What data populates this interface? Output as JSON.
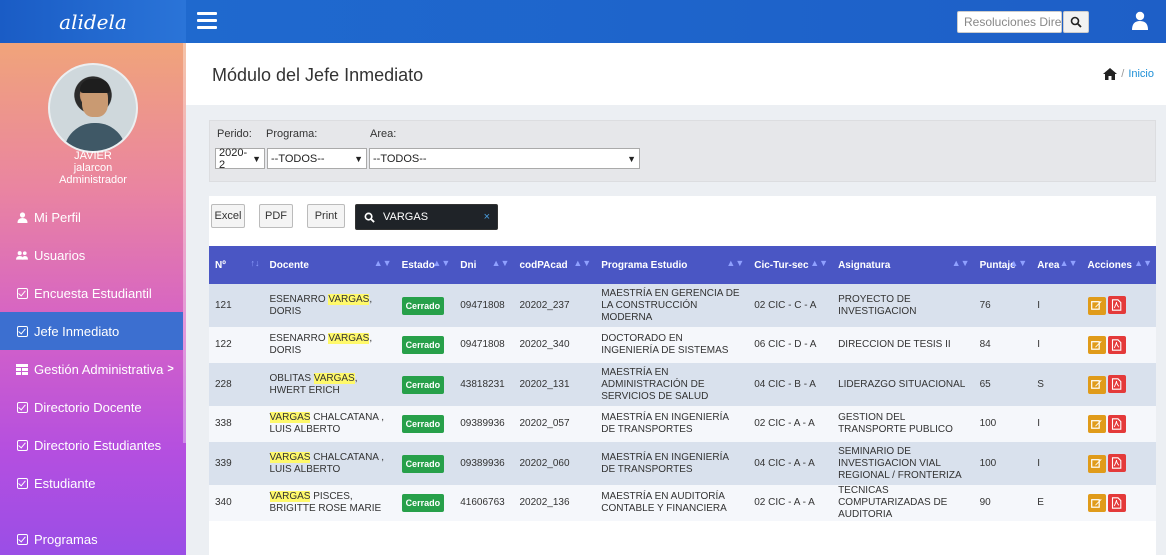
{
  "topbar": {
    "brand": "alidela",
    "search_placeholder": "Resoluciones Directo"
  },
  "sidebar": {
    "name": "JAVIER",
    "username": "jalarcon",
    "role": "Administrador",
    "items": [
      {
        "label": "Mi Perfil",
        "icon": "user-icon"
      },
      {
        "label": "Usuarios",
        "icon": "users-icon"
      },
      {
        "label": "Encuesta Estudiantil",
        "icon": "check-square-icon"
      },
      {
        "label": "Jefe Inmediato",
        "icon": "check-square-icon"
      },
      {
        "label": "Gestión Administrativa",
        "icon": "table-icon",
        "chevron": ">"
      },
      {
        "label": "Directorio Docente",
        "icon": "check-square-icon"
      },
      {
        "label": "Directorio Estudiantes",
        "icon": "check-square-icon"
      },
      {
        "label": "Estudiante",
        "icon": "check-square-icon"
      },
      {
        "label": "Programas",
        "icon": "check-square-icon"
      }
    ]
  },
  "header": {
    "title": "Módulo del Jefe Inmediato",
    "breadcrumb_sep": "/",
    "breadcrumb": "Inicio"
  },
  "filters": {
    "periodo_label": "Perido:",
    "periodo_value": "2020-2",
    "programa_label": "Programa:",
    "programa_value": "--TODOS--",
    "area_label": "Area:",
    "area_value": "--TODOS--"
  },
  "toolbar": {
    "excel": "Excel",
    "pdf": "PDF",
    "print": "Print",
    "search_value": "VARGAS",
    "clear": "×"
  },
  "table": {
    "columns": [
      "Nº",
      "Docente",
      "Estado",
      "Dni",
      "codPAcad",
      "Programa Estudio",
      "Cic-Tur-sec",
      "Asignatura",
      "Puntaje",
      "Area",
      "Acciones"
    ],
    "rows": [
      {
        "n": "121",
        "doc_pre": "ESENARRO ",
        "doc_hl": "VARGAS",
        "doc_post": ", DORIS",
        "estado": "Cerrado",
        "dni": "09471808",
        "cod": "20202_237",
        "programa": "MAESTRÍA EN GERENCIA DE LA CONSTRUCCIÓN MODERNA",
        "cic": "02 CIC - C - A",
        "asignatura": "PROYECTO DE INVESTIGACION",
        "puntaje": "76",
        "area": "I"
      },
      {
        "n": "122",
        "doc_pre": "ESENARRO ",
        "doc_hl": "VARGAS",
        "doc_post": ", DORIS",
        "estado": "Cerrado",
        "dni": "09471808",
        "cod": "20202_340",
        "programa": "DOCTORADO EN INGENIERÍA DE SISTEMAS",
        "cic": "06 CIC - D - A",
        "asignatura": "DIRECCION DE TESIS II",
        "puntaje": "84",
        "area": "I"
      },
      {
        "n": "228",
        "doc_pre": "OBLITAS ",
        "doc_hl": "VARGAS",
        "doc_post": ", HWERT ERICH",
        "estado": "Cerrado",
        "dni": "43818231",
        "cod": "20202_131",
        "programa": "MAESTRÍA EN ADMINISTRACIÓN DE SERVICIOS DE SALUD",
        "cic": "04 CIC - B - A",
        "asignatura": "LIDERAZGO SITUACIONAL",
        "puntaje": "65",
        "area": "S"
      },
      {
        "n": "338",
        "doc_pre": "",
        "doc_hl": "VARGAS",
        "doc_post": " CHALCATANA , LUIS ALBERTO",
        "estado": "Cerrado",
        "dni": "09389936",
        "cod": "20202_057",
        "programa": "MAESTRÍA EN INGENIERÍA DE TRANSPORTES",
        "cic": "02 CIC - A - A",
        "asignatura": "GESTION DEL TRANSPORTE PUBLICO",
        "puntaje": "100",
        "area": "I"
      },
      {
        "n": "339",
        "doc_pre": "",
        "doc_hl": "VARGAS",
        "doc_post": " CHALCATANA , LUIS ALBERTO",
        "estado": "Cerrado",
        "dni": "09389936",
        "cod": "20202_060",
        "programa": "MAESTRÍA EN INGENIERÍA DE TRANSPORTES",
        "cic": "04 CIC - A - A",
        "asignatura": "SEMINARIO DE INVESTIGACION VIAL REGIONAL / FRONTERIZA",
        "puntaje": "100",
        "area": "I"
      },
      {
        "n": "340",
        "doc_pre": "",
        "doc_hl": "VARGAS",
        "doc_post": " PISCES, BRIGITTE ROSE MARIE",
        "estado": "Cerrado",
        "dni": "41606763",
        "cod": "20202_136",
        "programa": "MAESTRÍA EN AUDITORÍA CONTABLE Y FINANCIERA",
        "cic": "02 CIC - A - A",
        "asignatura": "TECNICAS COMPUTARIZADAS DE AUDITORIA",
        "puntaje": "90",
        "area": "E"
      }
    ]
  }
}
